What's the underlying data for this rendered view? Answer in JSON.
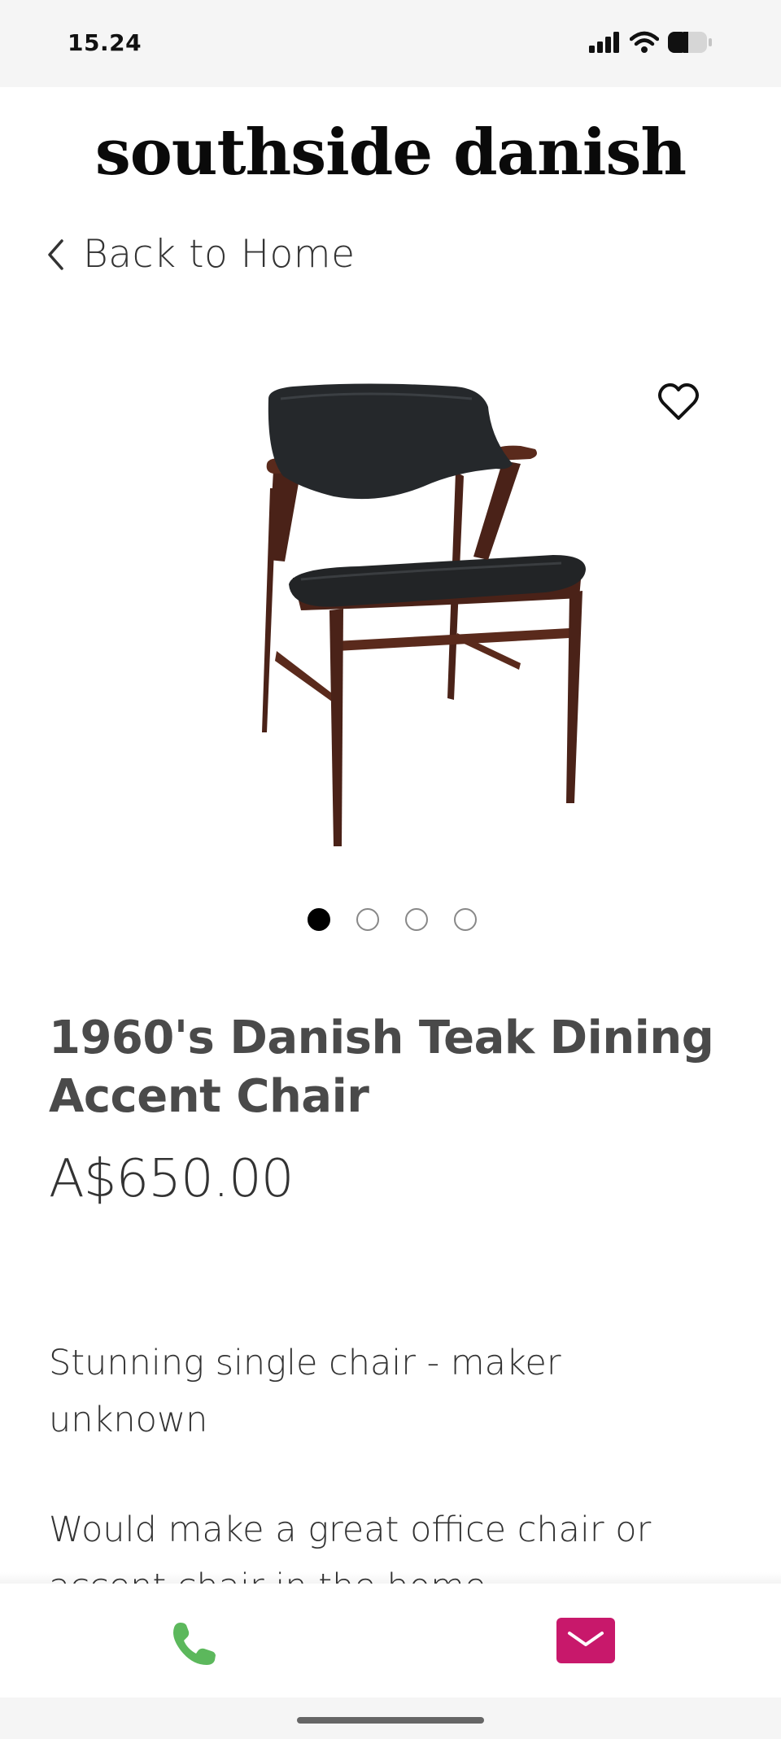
{
  "status_bar": {
    "time": "15.24",
    "icons": [
      "signal-icon",
      "wifi-icon",
      "battery-icon"
    ]
  },
  "brand": {
    "logo_text": "southside danish"
  },
  "nav": {
    "back_label": "Back to Home",
    "back_icon": "chevron-left-icon"
  },
  "gallery": {
    "wishlist_icon": "heart-outline-icon",
    "slide_count": 4,
    "active_slide": 1
  },
  "product": {
    "title": "1960's Danish Teak Dining Accent Chair",
    "price": "A$650.00",
    "description": [
      "Stunning single chair - maker unknown",
      "Would make a great office chair or accent chair in the home."
    ]
  },
  "actions": {
    "call_icon": "phone-icon",
    "email_icon": "envelope-icon",
    "call_color": "#5cb85c",
    "email_color": "#c8186b"
  }
}
